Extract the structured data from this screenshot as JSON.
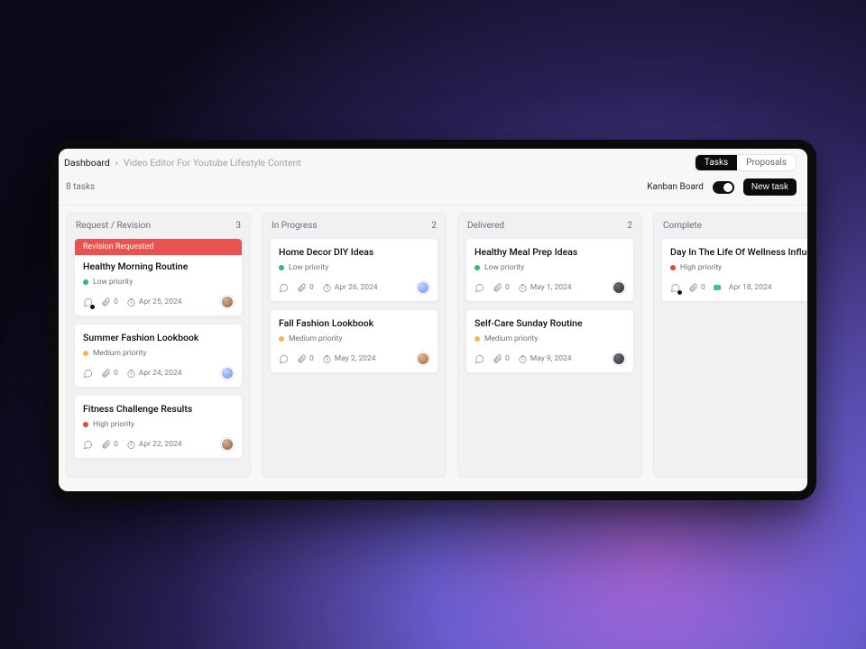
{
  "breadcrumb": {
    "root": "Dashboard",
    "current": "Video Editor For Youtube Lifestyle Content"
  },
  "tabs": {
    "tasks": "Tasks",
    "proposals": "Proposals"
  },
  "toolbar": {
    "task_count": "8 tasks",
    "view_label": "Kanban Board",
    "new_task": "New task"
  },
  "columns": [
    {
      "title": "Request / Revision",
      "count": "3"
    },
    {
      "title": "In Progress",
      "count": "2"
    },
    {
      "title": "Delivered",
      "count": "2"
    },
    {
      "title": "Complete",
      "count": ""
    }
  ],
  "cards": {
    "c0": {
      "banner": "Revision Requested",
      "title": "Healthy Morning Routine",
      "priority": "Low priority",
      "attach": "0",
      "date": "Apr 25, 2024"
    },
    "c1": {
      "title": "Summer Fashion Lookbook",
      "priority": "Medium priority",
      "attach": "0",
      "date": "Apr 24, 2024"
    },
    "c2": {
      "title": "Fitness Challenge Results",
      "priority": "High priority",
      "attach": "0",
      "date": "Apr 22, 2024"
    },
    "c3": {
      "title": "Home Decor DIY Ideas",
      "priority": "Low priority",
      "attach": "0",
      "date": "Apr 26, 2024"
    },
    "c4": {
      "title": "Fall Fashion Lookbook",
      "priority": "Medium priority",
      "attach": "0",
      "date": "May 2, 2024"
    },
    "c5": {
      "title": "Healthy Meal Prep Ideas",
      "priority": "Low priority",
      "attach": "0",
      "date": "May 1, 2024"
    },
    "c6": {
      "title": "Self-Care Sunday Routine",
      "priority": "Medium priority",
      "attach": "0",
      "date": "May 9, 2024"
    },
    "c7": {
      "title": "Day In The Life Of Wellness Influencer",
      "priority": "High priority",
      "attach": "0",
      "date": "Apr 18, 2024"
    }
  }
}
